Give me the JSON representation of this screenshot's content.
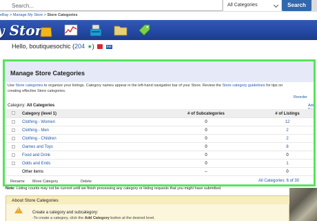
{
  "search": {
    "placeholder": "Search...",
    "category": "All Categories",
    "button": "Search"
  },
  "breadcrumb": [
    "eBay",
    "Manage My Store",
    "Store Categories"
  ],
  "banner": {
    "title": "y Store"
  },
  "hello": {
    "greeting": "Hello, boutiquesochic",
    "feedback": "204"
  },
  "panel": {
    "title": "Manage Store Categories",
    "intro_pre": "Use ",
    "intro_link1": "Store categories",
    "intro_mid": " to organize your listings. Category names appear in the left-hand navigation bar of your Store. Review the ",
    "intro_link2": "Store category guidelines",
    "intro_post": " for tips on",
    "intro_line2": "creating effective Store categories.",
    "reorder": "Reorder",
    "category_label": "Category:",
    "category_value": "All Categories",
    "add_sub": "Add Su"
  },
  "table": {
    "headers": {
      "name": "Category (level 1)",
      "subcats": "# of Subcategories",
      "listings": "# of Listings"
    },
    "rows": [
      {
        "name": "Clothing - Women",
        "subcats": "0",
        "listings": "12"
      },
      {
        "name": "Clothing - Men",
        "subcats": "0",
        "listings": "2"
      },
      {
        "name": "Clothing - Children",
        "subcats": "0",
        "listings": "2"
      },
      {
        "name": "Games and Toys",
        "subcats": "0",
        "listings": "8"
      },
      {
        "name": "Food and Drink",
        "subcats": "0",
        "listings": "0"
      },
      {
        "name": "Odds and Ends",
        "subcats": "0",
        "listings": "1"
      },
      {
        "name": "Other items",
        "subcats": "--",
        "listings": "0"
      }
    ]
  },
  "actions": {
    "rename": "Rename",
    "move": "Move Category",
    "delete": "Delete",
    "all_categories": "All Categories: 6 of 30"
  },
  "note": {
    "label": "Note:",
    "text": " Listing counts may not be current until we finish processing any category or listing requests that you might have submitted."
  },
  "about": {
    "title": "About Store Categories",
    "line1": "Create a category and subcategory:",
    "line2_pre": "-To create a category, click the ",
    "line2_bold": "Add Category",
    "line2_post": " button at the desired level."
  },
  "colors": {
    "accent": "#56e35d",
    "link": "#1f58a8",
    "banner": "#2a4fae",
    "search_button": "#3067ad"
  },
  "icons": [
    "search-icon",
    "shopping-bag-icon",
    "chart-icon",
    "cash-register-icon",
    "folder-icon",
    "price-tag-icon",
    "star-icon",
    "warning-icon"
  ]
}
